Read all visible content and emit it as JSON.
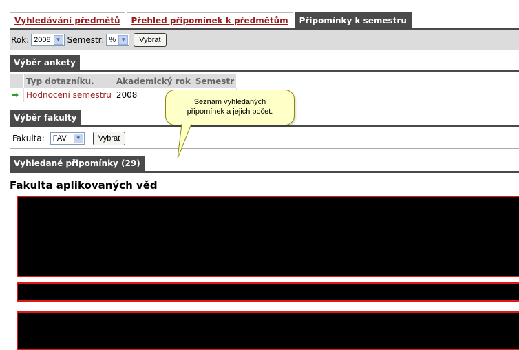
{
  "tabs": [
    {
      "label": "Vyhledávání předmětů"
    },
    {
      "label": "Přehled připomínek k předmětům"
    },
    {
      "label": "Připomínky k semestru"
    }
  ],
  "filters": {
    "year_label": "Rok:",
    "year_value": "2008",
    "semester_label": "Semestr:",
    "semester_value": "%",
    "submit_label": "Vybrat"
  },
  "poll_section": {
    "title": "Výběr ankety",
    "columns": [
      "Typ dotazníku.",
      "Akademický rok",
      "Semestr"
    ],
    "row": {
      "type": "Hodnocení semestru",
      "year": "2008"
    }
  },
  "faculty_section": {
    "title": "Výběr fakulty",
    "label": "Fakulta:",
    "value": "FAV",
    "submit_label": "Vybrat"
  },
  "results_section": {
    "title": "Vyhledané připomínky (29)",
    "faculty_heading": "Fakulta aplikovaných věd"
  },
  "tooltip": {
    "line1": "Seznam vyhledaných",
    "line2": "připomínek a jejich počet."
  },
  "colors": {
    "dark_header": "#4a4a4a",
    "link_red": "#9b1b1b",
    "tooltip_bg": "#ffffc8",
    "block_border": "#e01818"
  }
}
